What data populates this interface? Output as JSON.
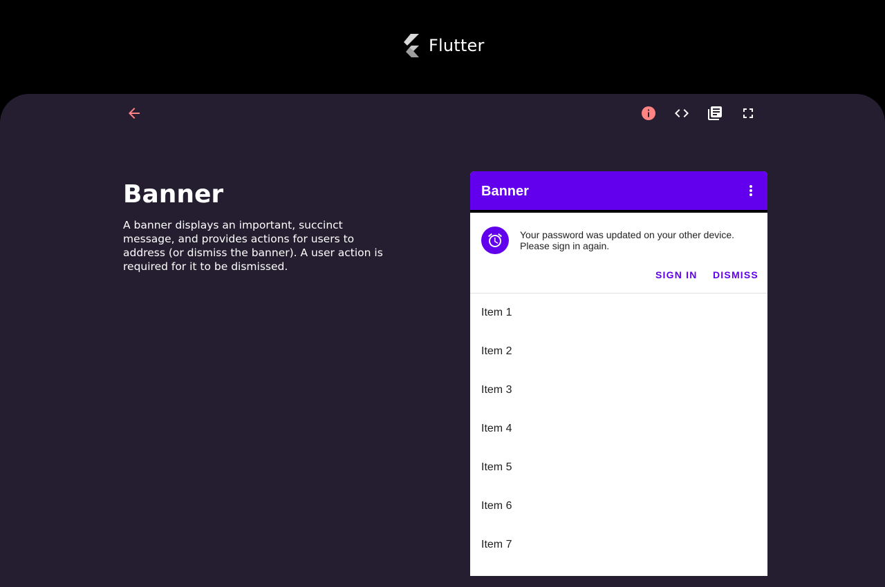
{
  "brand": {
    "name": "Flutter",
    "logo_icon": "flutter-logo-icon"
  },
  "toolbar": {
    "icons": [
      "arrow-back-icon",
      "info-icon",
      "code-icon",
      "library-books-icon",
      "fullscreen-icon"
    ],
    "accent_color": "#ff8383"
  },
  "demo": {
    "title": "Banner",
    "description": "A banner displays an important, succinct message, and provides actions for users to address (or dismiss the banner). A user action is required for it to be dismissed."
  },
  "device": {
    "appbar": {
      "title": "Banner",
      "menu_icon": "more-vert-icon",
      "color": "#6200ee"
    },
    "banner": {
      "icon": "access-alarm-icon",
      "message": "Your password was updated on your other device. Please sign in again.",
      "actions": {
        "sign_in": "SIGN IN",
        "dismiss": "DISMISS"
      }
    },
    "list": {
      "items": [
        "Item 1",
        "Item 2",
        "Item 3",
        "Item 4",
        "Item 5",
        "Item 6",
        "Item 7"
      ]
    }
  },
  "colors": {
    "page_background": "#000000",
    "stage_background": "#241e30",
    "primary": "#6200ee",
    "surface": "#ffffff"
  }
}
